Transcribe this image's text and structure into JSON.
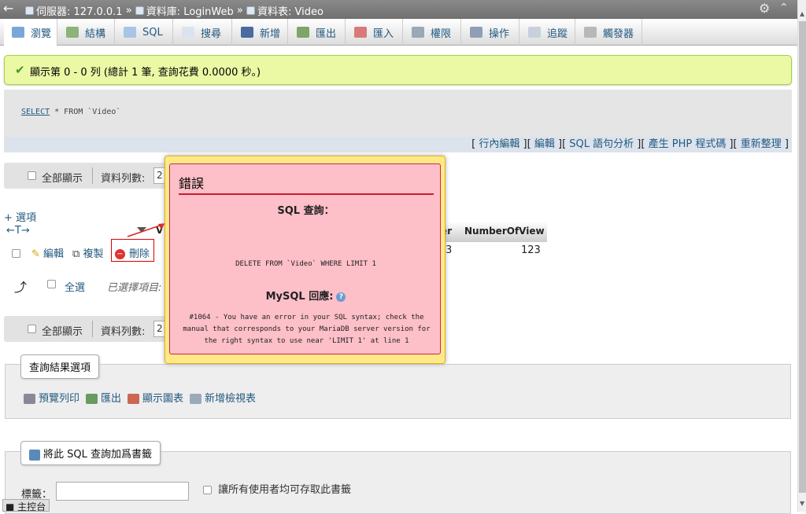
{
  "breadcrumb": {
    "server": "伺服器: 127.0.0.1",
    "sep": "»",
    "database": "資料庫: LoginWeb",
    "table": "資料表: Video"
  },
  "tabs": [
    {
      "label": "瀏覽"
    },
    {
      "label": "結構"
    },
    {
      "label": "SQL"
    },
    {
      "label": "搜尋"
    },
    {
      "label": "新增"
    },
    {
      "label": "匯出"
    },
    {
      "label": "匯入"
    },
    {
      "label": "權限"
    },
    {
      "label": "操作"
    },
    {
      "label": "追蹤"
    },
    {
      "label": "觸發器"
    }
  ],
  "success": {
    "text": "顯示第 0 - 0 列 (總計 1 筆, 查詢花費 0.0000 秒。)"
  },
  "query": {
    "keyword": "SELECT",
    "rest": " * FROM `Video`"
  },
  "query_links": {
    "open": "[",
    "close": "]",
    "inline_edit": "行內編輯",
    "edit": "編輯",
    "explain": "SQL 語句分析",
    "create_php": "產生 PHP 程式碼",
    "refresh": "重新整理"
  },
  "nav": {
    "show_all": "全部顯示",
    "rows_label": "資料列數:",
    "rows_value": "2"
  },
  "options": "+ 選項",
  "arrows": "←T→",
  "columns": {
    "v": "V",
    "er": "er",
    "number_of_view": "NumberOfView"
  },
  "row": {
    "edit": "編輯",
    "copy": "複製",
    "delete": "刪除",
    "cell_partial": "3",
    "number_of_view": "123"
  },
  "select_all": {
    "label": "全選",
    "with_selected": "已選擇項目:"
  },
  "query_results": {
    "legend": "查詢結果選項",
    "print": "預覽列印",
    "export": "匯出",
    "chart": "顯示圖表",
    "view": "新增檢視表"
  },
  "bookmark": {
    "legend": "將此 SQL 查詢加爲書籤",
    "label": "標籤：",
    "share": "讓所有使用者均可存取此書籤"
  },
  "console": "主控台",
  "error": {
    "title": "錯誤",
    "sql_label": "SQL 查詢：",
    "query": "DELETE FROM `Video` WHERE  LIMIT 1",
    "mysql_label": "MySQL 回應:",
    "help": "?",
    "message": "#1064 - You have an error in your SQL syntax; check the manual that corresponds to your MariaDB server version for the right syntax to use near 'LIMIT 1' at line 1"
  }
}
